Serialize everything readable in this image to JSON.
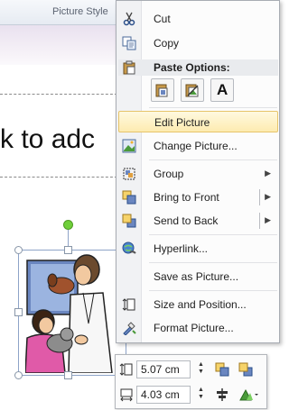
{
  "ribbon": {
    "group_label": "Picture Style"
  },
  "slide": {
    "placeholder_text": "k to adc"
  },
  "context_menu": {
    "items": [
      {
        "label": "Cut",
        "icon": "scissors-icon"
      },
      {
        "label": "Copy",
        "icon": "copy-icon"
      },
      {
        "label": "Edit Picture",
        "icon": "",
        "highlighted": true
      },
      {
        "label": "Change Picture...",
        "icon": "change-picture-icon"
      },
      {
        "label": "Group",
        "icon": "group-icon",
        "submenu": true
      },
      {
        "label": "Bring to Front",
        "icon": "bring-to-front-icon",
        "submenu": true,
        "split": true
      },
      {
        "label": "Send to Back",
        "icon": "send-to-back-icon",
        "submenu": true,
        "split": true
      },
      {
        "label": "Hyperlink...",
        "icon": "hyperlink-icon"
      },
      {
        "label": "Save as Picture...",
        "icon": ""
      },
      {
        "label": "Size and Position...",
        "icon": "size-position-icon"
      },
      {
        "label": "Format Picture...",
        "icon": "format-picture-icon"
      }
    ],
    "paste_options": {
      "header": "Paste Options:",
      "buttons": [
        {
          "name": "use-destination-theme",
          "icon": "paste-destination-icon"
        },
        {
          "name": "picture",
          "icon": "paste-picture-icon"
        },
        {
          "name": "keep-text-only",
          "icon": "paste-text-only-icon",
          "glyph": "A"
        }
      ]
    },
    "colors": {
      "highlight_border": "#e6c46a",
      "highlight_fill": "#fdebb0"
    }
  },
  "mini_toolbar": {
    "height_value": "5.07 cm",
    "width_value": "4.03 cm"
  },
  "selection": {
    "rotate_handle_color": "#6fcf3a"
  }
}
